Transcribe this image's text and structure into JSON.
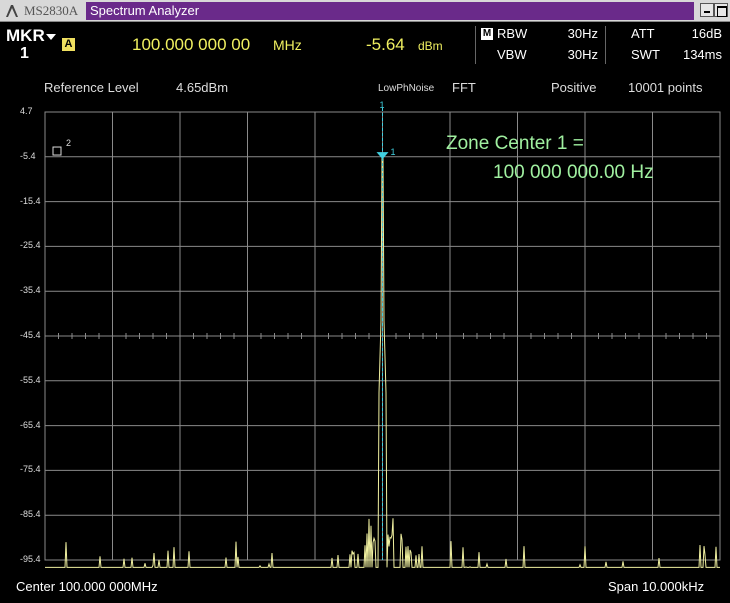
{
  "titlebar": {
    "model": "MS2830A",
    "app_title": "Spectrum Analyzer"
  },
  "marker": {
    "label": "MKR",
    "number": "1",
    "trace_badge": "A",
    "frequency": "100.000 000 00",
    "frequency_unit": "MHz",
    "level": "-5.64",
    "level_unit": "dBm"
  },
  "params": {
    "mode_badge": "M",
    "rbw_label": "RBW",
    "rbw_value": "30Hz",
    "vbw_label": "VBW",
    "vbw_value": "30Hz",
    "att_label": "ATT",
    "att_value": "16dB",
    "swt_label": "SWT",
    "swt_value": "134ms"
  },
  "settings": {
    "ref_level_label": "Reference Level",
    "ref_level_value": "4.65dBm",
    "noise_mode": "LowPhNoise",
    "analysis": "FFT",
    "detector": "Positive",
    "points": "10001 points"
  },
  "graph": {
    "y_ticks": [
      "4.7",
      "-5.4",
      "-15.4",
      "-25.4",
      "-35.4",
      "-45.4",
      "-55.4",
      "-65.4",
      "-75.4",
      "-85.4",
      "-95.4"
    ],
    "y_top_dbm": 4.65,
    "y_div_db": 10,
    "marker1_label": "1",
    "marker1_top_label": "1",
    "marker2_label": "2",
    "marker2_level_dbm": -5.4,
    "zone_line1": "Zone Center 1 =",
    "zone_line2": "100 000 000.00 Hz",
    "trace_color": "#f0f0a0",
    "marker_color": "#40d0e0",
    "grid_color": "#8a8a8a",
    "zone_color": "#a0f0a0",
    "peak_dbm": -5.64,
    "noise_floor_dbm": -97
  },
  "footer": {
    "center": "Center 100.000 000MHz",
    "span": "Span 10.000kHz"
  }
}
